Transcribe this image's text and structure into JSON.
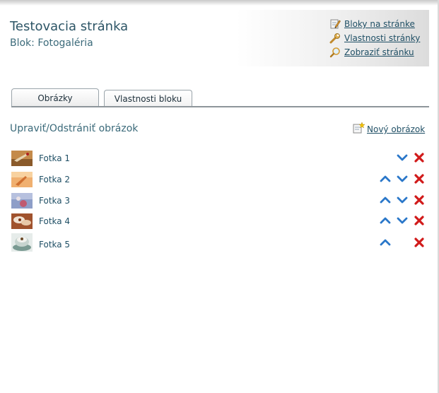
{
  "header": {
    "title": "Testovacia stránka",
    "block_label": "Blok: Fotogaléria"
  },
  "header_links": [
    {
      "label": "Bloky na stránke",
      "icon": "pencil-page-icon"
    },
    {
      "label": "Vlastnosti stránky",
      "icon": "wrench-icon"
    },
    {
      "label": "Zobraziť stránku",
      "icon": "magnifier-icon"
    }
  ],
  "tabs": [
    {
      "label": "Obrázky",
      "active": true
    },
    {
      "label": "Vlastnosti bloku",
      "active": false
    }
  ],
  "section": {
    "title": "Upraviť/Odstrániť obrázok",
    "new_image_label": "Nový obrázok"
  },
  "images": [
    {
      "name": "Fotka 1",
      "can_move_up": false,
      "can_move_down": true
    },
    {
      "name": "Fotka 2",
      "can_move_up": true,
      "can_move_down": true
    },
    {
      "name": "Fotka 3",
      "can_move_up": true,
      "can_move_down": true
    },
    {
      "name": "Fotka 4",
      "can_move_up": true,
      "can_move_down": true
    },
    {
      "name": "Fotka 5",
      "can_move_up": true,
      "can_move_down": false
    }
  ],
  "colors": {
    "text": "#2d5566",
    "link": "#1f4f65",
    "arrow": "#2a77c9",
    "delete": "#d11a1a"
  }
}
